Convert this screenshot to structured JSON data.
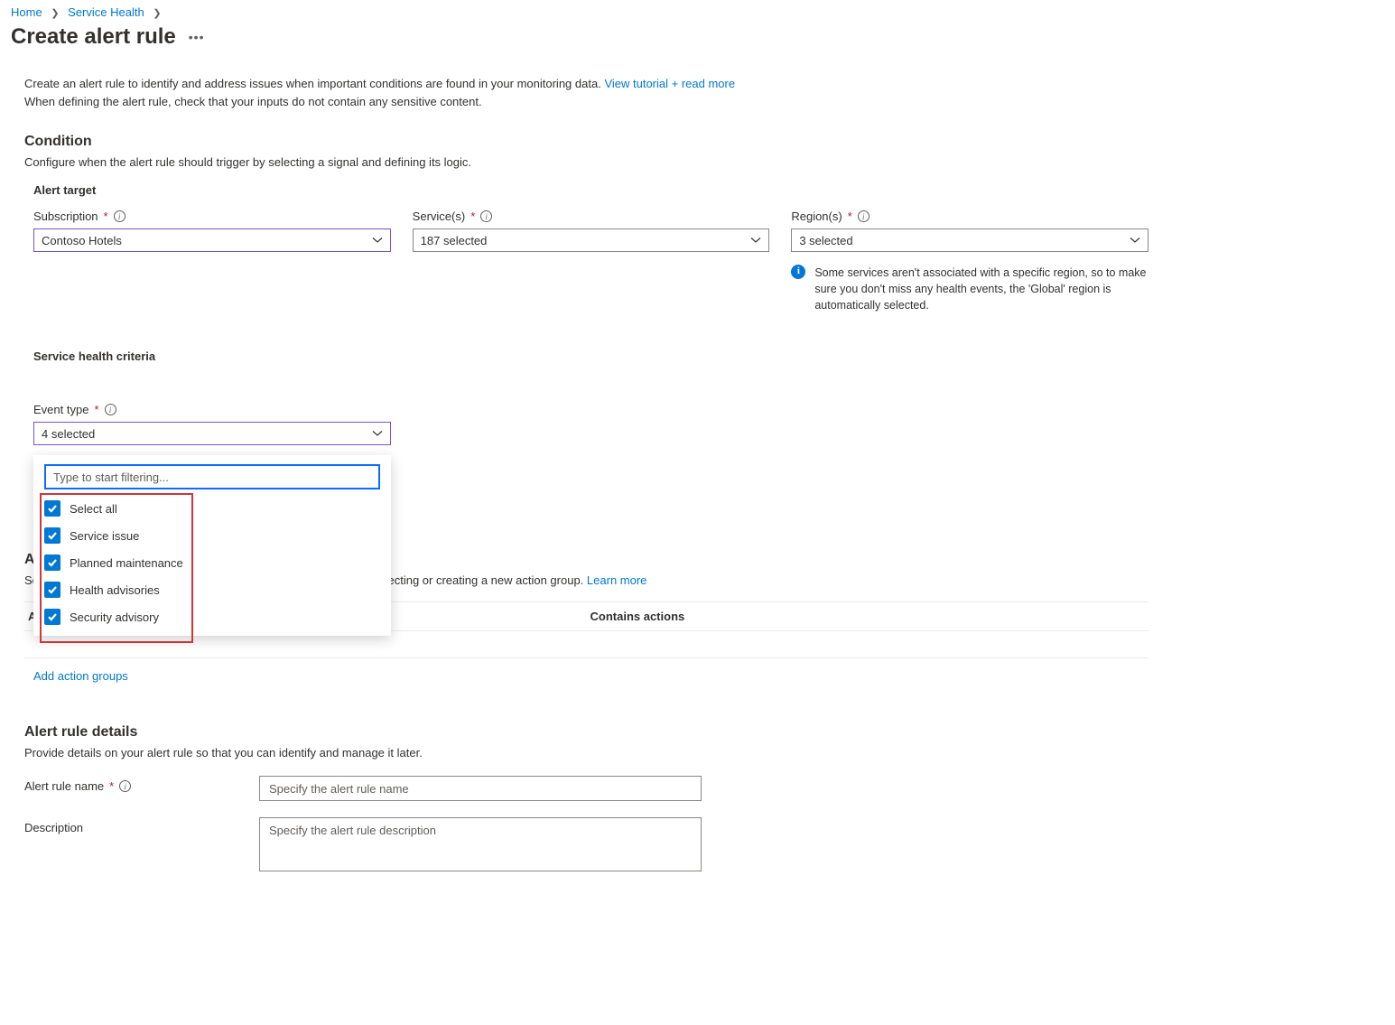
{
  "breadcrumb": {
    "home": "Home",
    "service_health": "Service Health"
  },
  "page": {
    "title": "Create alert rule"
  },
  "intro": {
    "line1": "Create an alert rule to identify and address issues when important conditions are found in your monitoring data.",
    "tutorial_link": "View tutorial + read more",
    "line2": "When defining the alert rule, check that your inputs do not contain any sensitive content."
  },
  "condition": {
    "heading": "Condition",
    "desc": "Configure when the alert rule should trigger by selecting a signal and defining its logic.",
    "alert_target_heading": "Alert target",
    "subscription": {
      "label": "Subscription",
      "value": "Contoso Hotels"
    },
    "services": {
      "label": "Service(s)",
      "value": "187 selected"
    },
    "regions": {
      "label": "Region(s)",
      "value": "3 selected",
      "note": "Some services aren't associated with a specific region, so to make sure you don't miss any health events, the 'Global' region is automatically selected."
    },
    "criteria_heading": "Service health criteria",
    "event_type": {
      "label": "Event type",
      "value": "4 selected",
      "filter_placeholder": "Type to start filtering...",
      "options": [
        "Select all",
        "Service issue",
        "Planned maintenance",
        "Health advisories",
        "Security advisory"
      ]
    }
  },
  "actions": {
    "heading": "Actions",
    "desc_pre": "Send notifications or invoke actions when the alert rule triggers, by selecting or creating a new action group.",
    "learn_more": "Learn more",
    "col1": "Action group name",
    "col2": "Contains actions",
    "add_link": "Add action groups"
  },
  "details": {
    "heading": "Alert rule details",
    "desc": "Provide details on your alert rule so that you can identify and manage it later.",
    "name_label": "Alert rule name",
    "name_placeholder": "Specify the alert rule name",
    "desc_label": "Description",
    "desc_placeholder": "Specify the alert rule description"
  }
}
